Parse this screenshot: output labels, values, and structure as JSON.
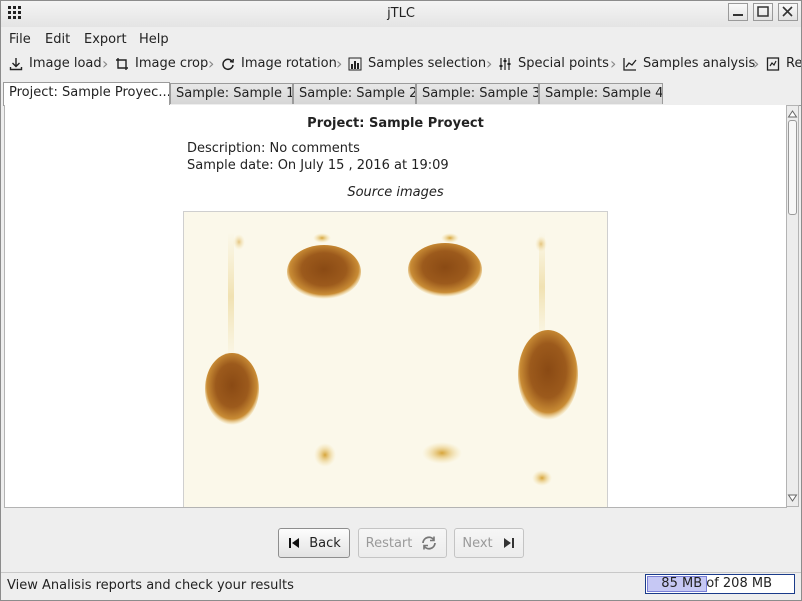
{
  "window": {
    "title": "jTLC"
  },
  "menu": [
    "File",
    "Edit",
    "Export",
    "Help"
  ],
  "toolbar": [
    {
      "label": "Image load",
      "icon": "download-icon"
    },
    {
      "label": "Image crop",
      "icon": "crop-icon"
    },
    {
      "label": "Image rotation",
      "icon": "rotate-icon"
    },
    {
      "label": "Samples selection",
      "icon": "bar-chart-icon"
    },
    {
      "label": "Special points",
      "icon": "sliders-icon"
    },
    {
      "label": "Samples analysis",
      "icon": "line-chart-icon"
    },
    {
      "label": "Re",
      "icon": "report-icon"
    }
  ],
  "tabs": [
    "Project: Sample Proyec...",
    "Sample: Sample 1",
    "Sample: Sample 2",
    "Sample: Sample 3",
    "Sample: Sample 4"
  ],
  "active_tab": 0,
  "project": {
    "title": "Project: Sample Proyect",
    "description": "Description: No comments",
    "sample_date": "Sample date: On July 15 , 2016 at 19:09",
    "source_images_label": "Source images"
  },
  "buttons": {
    "back": "Back",
    "restart": "Restart",
    "next": "Next"
  },
  "status": {
    "message": "View Analisis reports and check your results",
    "memory_used": "85 MB",
    "memory_total": "of 208 MB",
    "memory_fraction": 0.41
  }
}
